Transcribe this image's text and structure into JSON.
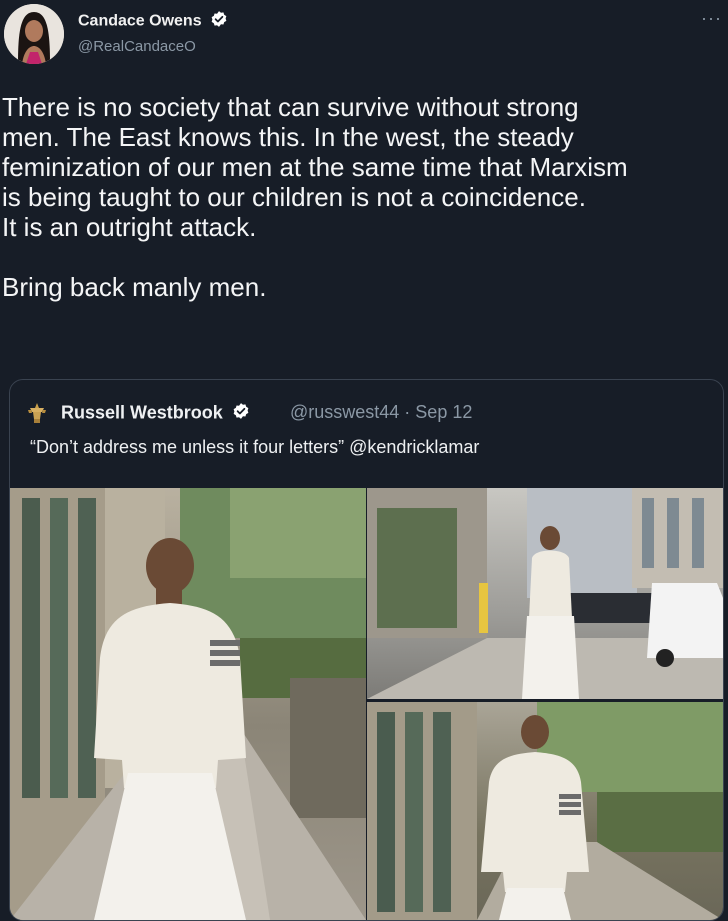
{
  "tweet": {
    "display_name": "Candace Owens",
    "handle": "@RealCandaceO",
    "text": "There is no society that can survive without strong\nmen. The East knows this. In the west, the steady\nfeminization of our men at the same time that Marxism\nis being taught to our children is not a coincidence.\nIt is an outright attack.\n\nBring back manly men.",
    "more_icon": "more-icon"
  },
  "quoted_tweet": {
    "display_name": "Russell Westbrook",
    "meta": "@russwest44 · Sep 12",
    "text": "“Don’t address me unless it four letters” @kendricklamar"
  },
  "colors": {
    "background": "#171d27",
    "verified_badge": "#ffffff",
    "secondary_text": "#8b98a5"
  }
}
